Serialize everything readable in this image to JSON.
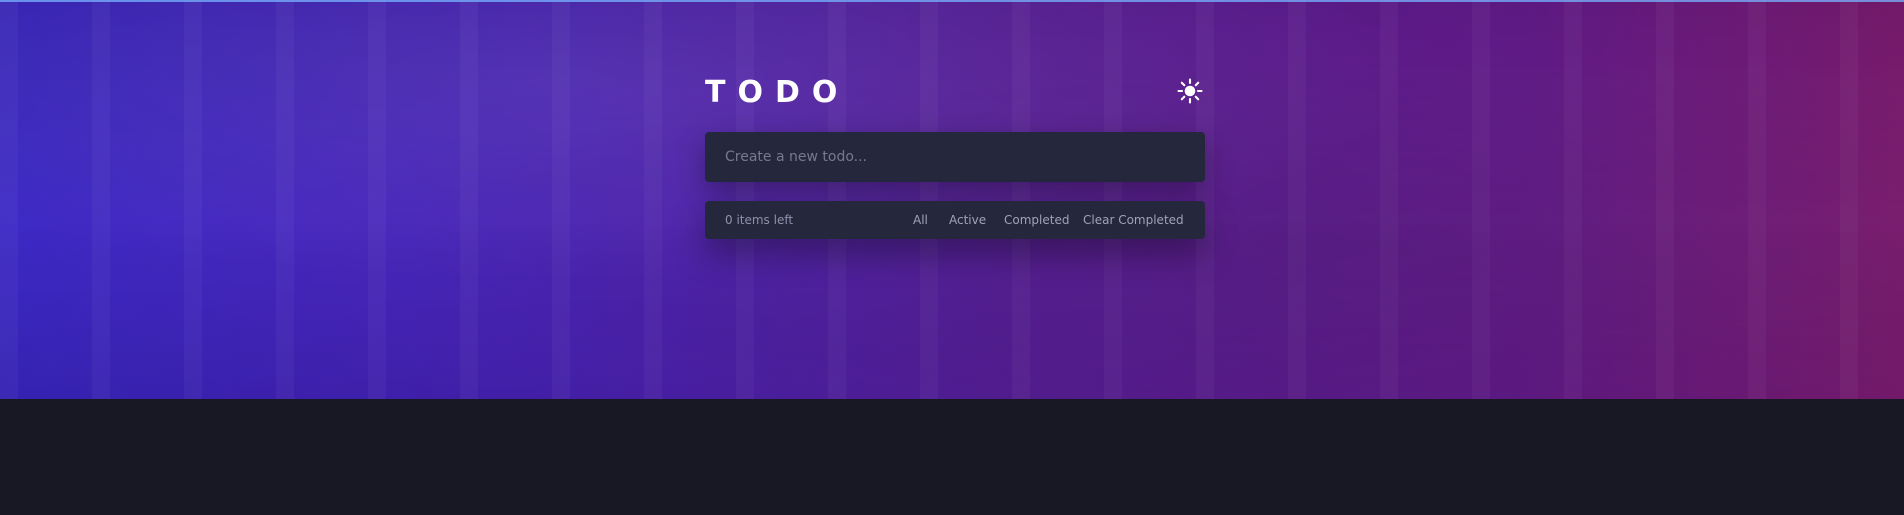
{
  "app": {
    "title": "TODO",
    "theme_toggle": {
      "icon": "sun-icon"
    }
  },
  "input": {
    "placeholder": "Create a new todo..."
  },
  "footer": {
    "items_left": "0 items left",
    "filters": {
      "all": "All",
      "active": "Active",
      "completed": "Completed"
    },
    "clear_completed": "Clear Completed"
  },
  "colors": {
    "background": "#181824",
    "panel": "#25273c",
    "gradient_start": "#3a26c4",
    "gradient_end": "#7e1c73",
    "text_muted": "#8f92ad",
    "text_light": "#ffffff"
  }
}
